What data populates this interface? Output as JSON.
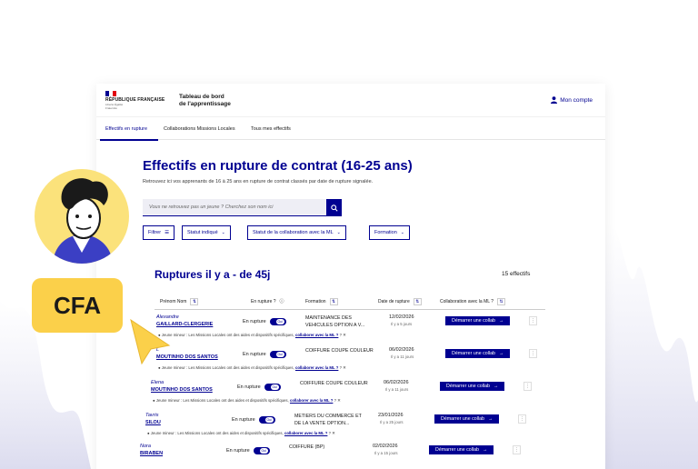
{
  "header": {
    "republic": "RÉPUBLIQUE FRANÇAISE",
    "motto": "Liberté Égalité Fraternité",
    "app_title_line1": "Tableau de bord",
    "app_title_line2": "de l'apprentissage",
    "account_label": "Mon compte"
  },
  "nav": {
    "items": [
      "Effectifs en rupture",
      "Collaborations Missions Locales",
      "Tous mes effectifs"
    ],
    "active": "Effectifs en rupture"
  },
  "page": {
    "title": "Effectifs en rupture de contrat (16-25 ans)",
    "subtitle": "Retrouvez ici vos apprenants de 16 à 25 ans en rupture de contrat classés par date de rupture signalée."
  },
  "search": {
    "placeholder": "Vous ne retrouvez pas un jeune ? Cherchez son nom ici"
  },
  "filters": {
    "filter_label": "Filtrer",
    "status": "Statut indiqué",
    "collab_status": "Statut de la collaboration avec la ML",
    "formation": "Formation"
  },
  "section": {
    "title": "Ruptures il y a - de 45j",
    "count": "15 effectifs"
  },
  "table": {
    "headers": [
      "Prénom Nom",
      "En rupture ?",
      "Formation",
      "Date de rupture",
      "Collaboration avec la ML ?"
    ],
    "rows": [
      {
        "first": "Alexandre",
        "last": "GAILLARD-CLERGERIE",
        "status": "En rupture",
        "toggle": "Oui",
        "formation": "MAINTENANCE DES VEHICULES OPTION A V...",
        "date": "12/02/2026",
        "ago": "Il y a 5 jours",
        "collab": "Démarrer une collab",
        "note_pre": "Jeune mineur : Les Missions Locales ont des aides et dispositifs spécifiques,",
        "note_link": "collaborer avec la ML ?"
      },
      {
        "first": "L",
        "last": "MOUTINHO DOS SANTOS",
        "status": "En rupture",
        "toggle": "Oui",
        "formation": "COIFFURE COUPE COULEUR",
        "date": "06/02/2026",
        "ago": "Il y a 11 jours",
        "collab": "Démarrer une collab",
        "note_pre": "Jeune mineur : Les Missions Locales ont des aides et dispositifs spécifiques,",
        "note_link": "collaborer avec la ML ?"
      },
      {
        "first": "Elena",
        "last": "MOUTINHO DOS SANTOS",
        "status": "En rupture",
        "toggle": "Oui",
        "formation": "COIFFURE COUPE COULEUR",
        "date": "06/02/2026",
        "ago": "Il y a 11 jours",
        "collab": "Démarrer une collab",
        "note_pre": "Jeune mineur : Les Missions Locales ont des aides et dispositifs spécifiques,",
        "note_link": "collaborer avec la ML ?"
      },
      {
        "first": "Tavris",
        "last": "SILOU",
        "status": "En rupture",
        "toggle": "Oui",
        "formation": "METIERS DU COMMERCE ET DE LA VENTE OPTION...",
        "date": "23/01/2026",
        "ago": "Il y a 25 jours",
        "collab": "Démarrer une collab",
        "note_pre": "Jeune mineur : Les Missions Locales ont des aides et dispositifs spécifiques,",
        "note_link": "collaborer avec la ML ?"
      },
      {
        "first": "Nora",
        "last": "BIRABEN",
        "status": "En rupture",
        "toggle": "Oui",
        "formation": "COIFFURE (BP)",
        "date": "02/02/2026",
        "ago": "Il y a 15 jours",
        "collab": "Démarrer une collab",
        "note_pre": "",
        "note_link": ""
      }
    ]
  },
  "badge": {
    "label": "CFA"
  },
  "colors": {
    "primary": "#000091",
    "badge": "#fbd04a",
    "avatar_bg": "#fbe27b"
  }
}
